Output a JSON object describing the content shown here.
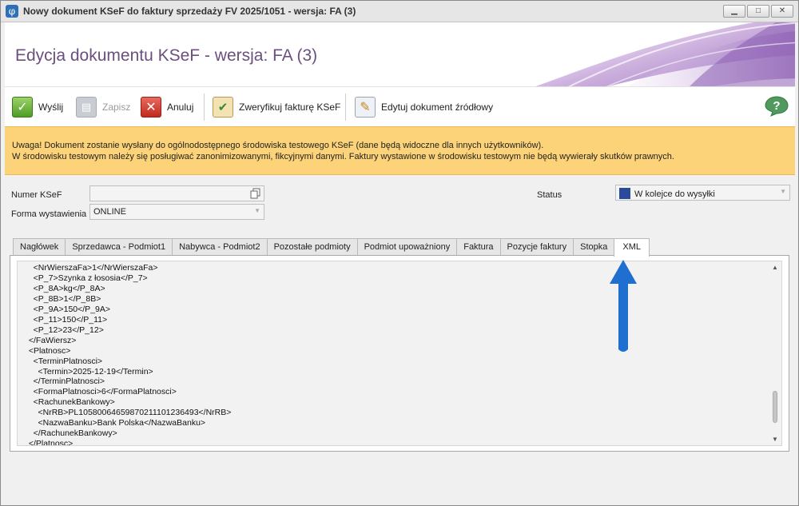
{
  "window": {
    "title": "Nowy dokument KSeF do faktury sprzedaży FV 2025/1051 - wersja: FA (3)",
    "app_icon_glyph": "φ",
    "controls": {
      "minimize": "▁",
      "maximize": "□",
      "close": "✕"
    }
  },
  "header": {
    "title": "Edycja dokumentu KSeF - wersja: FA (3)"
  },
  "toolbar": {
    "send_label": "Wyślij",
    "save_label": "Zapisz",
    "cancel_label": "Anuluj",
    "verify_label": "Zweryfikuj fakturę KSeF",
    "edit_source_label": "Edytuj dokument źródłowy",
    "help_glyph": "?"
  },
  "warning": {
    "line1": "Uwaga! Dokument zostanie wysłany do ogólnodostępnego środowiska testowego KSeF (dane będą widoczne dla innych użytkowników).",
    "line2": "W środowisku testowym należy się posługiwać zanonimizowanymi, fikcyjnymi danymi. Faktury wystawione w środowisku testowym nie będą wywierały skutków prawnych.",
    "color": "#fcd379"
  },
  "form": {
    "numer_ksef_label": "Numer KSeF",
    "numer_ksef_value": "",
    "forma_label": "Forma wystawienia",
    "forma_value": "ONLINE",
    "status_label": "Status",
    "status_value": "W kolejce do wysyłki",
    "status_color": "#2c4a9c"
  },
  "tabs": [
    {
      "label": "Nagłówek"
    },
    {
      "label": "Sprzedawca - Podmiot1"
    },
    {
      "label": "Nabywca - Podmiot2"
    },
    {
      "label": "Pozostałe podmioty"
    },
    {
      "label": "Podmiot upoważniony"
    },
    {
      "label": "Faktura"
    },
    {
      "label": "Pozycje faktury"
    },
    {
      "label": "Stopka"
    },
    {
      "label": "XML"
    }
  ],
  "active_tab": "XML",
  "xml_lines": [
    "    <NrWierszaFa>1</NrWierszaFa>",
    "    <P_7>Szynka z łososia</P_7>",
    "    <P_8A>kg</P_8A>",
    "    <P_8B>1</P_8B>",
    "    <P_9A>150</P_9A>",
    "    <P_11>150</P_11>",
    "    <P_12>23</P_12>",
    "  </FaWiersz>",
    "  <Platnosc>",
    "    <TerminPlatnosci>",
    "      <Termin>2025-12-19</Termin>",
    "    </TerminPlatnosci>",
    "    <FormaPlatnosci>6</FormaPlatnosci>",
    "    <RachunekBankowy>",
    "      <NrRB>PL10580064659870211101236493</NrRB>",
    "      <NazwaBanku>Bank Polska</NazwaBanku>",
    "    </RachunekBankowy>",
    "  </Platnosc>"
  ],
  "annotation": {
    "arrow_color": "#1f6fd1"
  }
}
